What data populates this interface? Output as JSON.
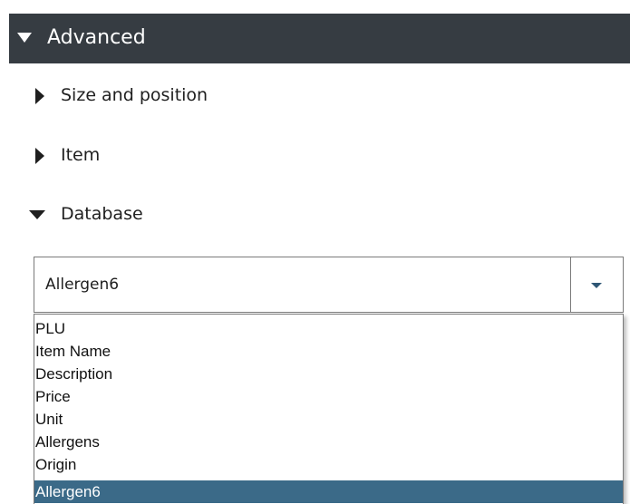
{
  "advanced_section": {
    "title": "Advanced",
    "expanded": true
  },
  "sub_sections": [
    {
      "label": "Size and position",
      "expanded": false
    },
    {
      "label": "Item",
      "expanded": false
    },
    {
      "label": "Database",
      "expanded": true
    }
  ],
  "database_field": {
    "selected_value": "Allergen6",
    "options": [
      "PLU",
      "Item Name",
      "Description",
      "Price",
      "Unit",
      "Allergens",
      "Origin",
      "Allergen6"
    ],
    "highlighted_option": "Allergen6"
  },
  "colors": {
    "header_bg": "#363c42",
    "selected_bg": "#3b6a88",
    "dropdown_arrow": "#2f5775"
  }
}
